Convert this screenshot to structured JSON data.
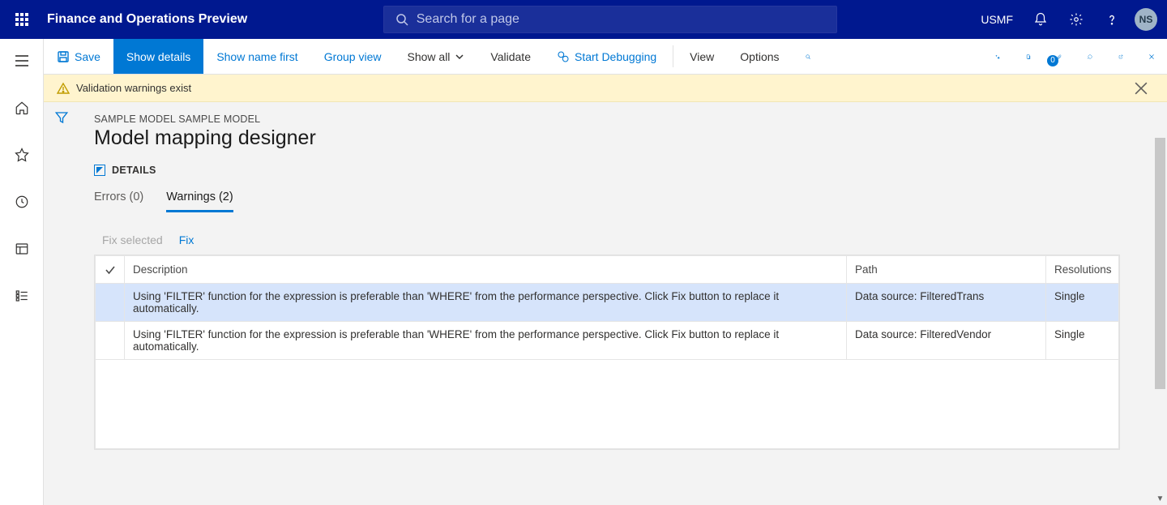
{
  "topbar": {
    "brand": "Finance and Operations Preview",
    "search_placeholder": "Search for a page",
    "company": "USMF",
    "avatar_initials": "NS"
  },
  "actionbar": {
    "save": "Save",
    "show_details": "Show details",
    "show_name_first": "Show name first",
    "group_view": "Group view",
    "show_all": "Show all",
    "validate": "Validate",
    "start_debugging": "Start Debugging",
    "view": "View",
    "options": "Options",
    "badge_count": "0"
  },
  "warnbar": {
    "text": "Validation warnings exist"
  },
  "page": {
    "crumb": "SAMPLE MODEL SAMPLE MODEL",
    "title": "Model mapping designer",
    "details_label": "DETAILS"
  },
  "tabs": {
    "errors": "Errors (0)",
    "warnings": "Warnings (2)"
  },
  "toolbar2": {
    "fix_selected": "Fix selected",
    "fix": "Fix"
  },
  "grid": {
    "headers": {
      "description": "Description",
      "path": "Path",
      "resolutions": "Resolutions"
    },
    "rows": [
      {
        "description": "Using 'FILTER' function for the expression is preferable than 'WHERE' from the performance perspective. Click Fix button to replace it automatically.",
        "path": "Data source: FilteredTrans",
        "resolutions": "Single"
      },
      {
        "description": "Using 'FILTER' function for the expression is preferable than 'WHERE' from the performance perspective. Click Fix button to replace it automatically.",
        "path": "Data source: FilteredVendor",
        "resolutions": "Single"
      }
    ]
  }
}
